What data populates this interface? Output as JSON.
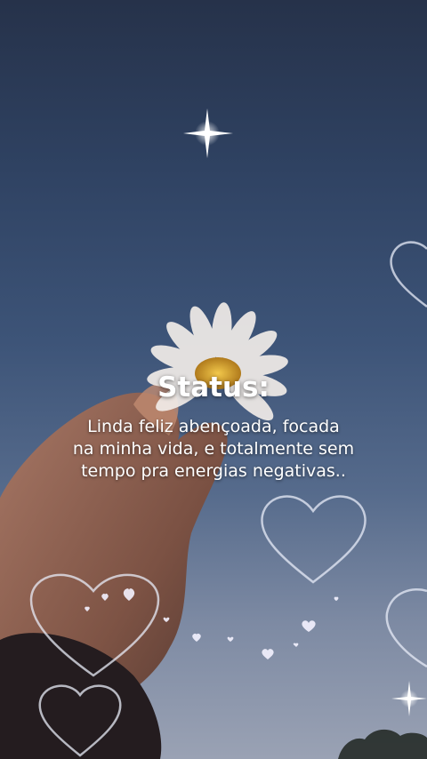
{
  "post": {
    "title": "Status:",
    "caption_lines": [
      "Linda feliz abençoada, focada",
      "na minha vida, e totalmente sem",
      "tempo pra energias negativas.."
    ]
  },
  "colors": {
    "sky_top": "#26324a",
    "sky_bottom": "#9aa2b4",
    "text": "#ffffff",
    "heart_outline": "#e8ecf8",
    "petal": "#f1ece8",
    "flower_center": "#e3b23c"
  },
  "icons": [
    "sparkle-icon",
    "heart-outline-icon",
    "daisy-flower",
    "hand"
  ]
}
